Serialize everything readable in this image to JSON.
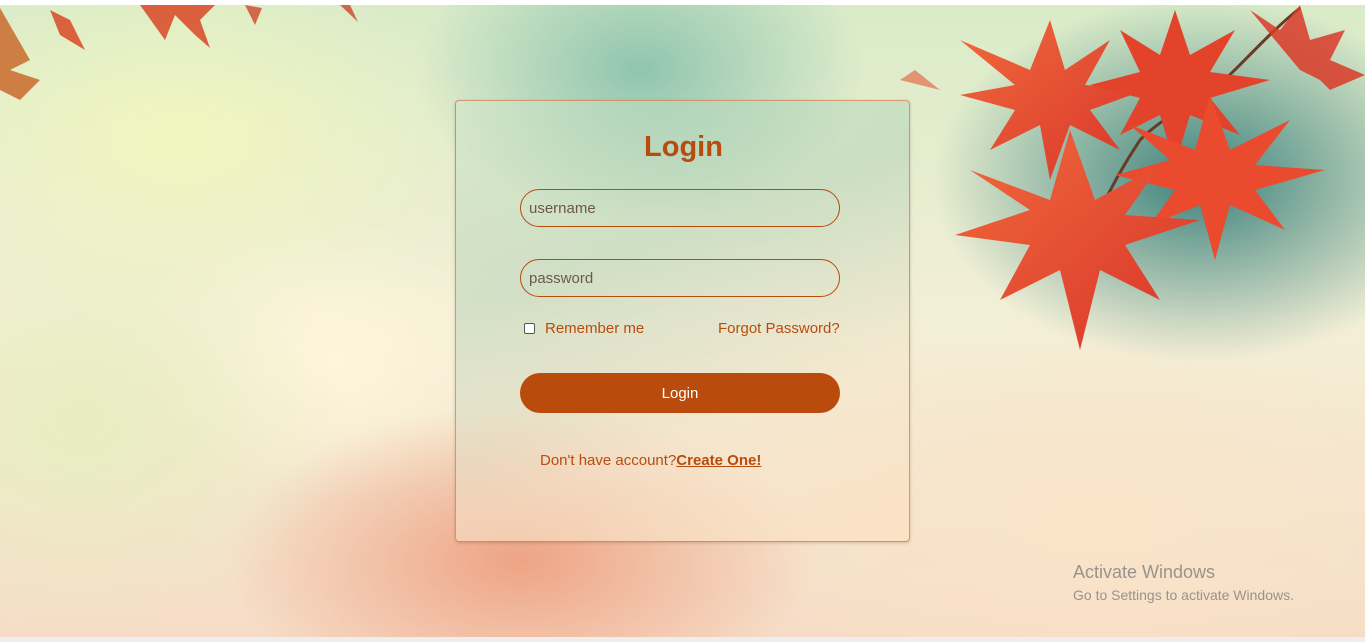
{
  "login": {
    "title": "Login",
    "username_placeholder": "username",
    "password_placeholder": "password",
    "remember_label": "Remember me",
    "remember_checked": false,
    "forgot_label": "Forgot Password?",
    "button_label": "Login",
    "signup_text": "Don't have account?",
    "signup_link": "Create One!"
  },
  "watermark": {
    "title": "Activate Windows",
    "subtitle": "Go to Settings to activate Windows."
  },
  "colors": {
    "accent": "#b94b0d",
    "leaf": "#e8492f"
  },
  "icons": [
    "maple-leaf-decoration",
    "checkbox-icon"
  ]
}
